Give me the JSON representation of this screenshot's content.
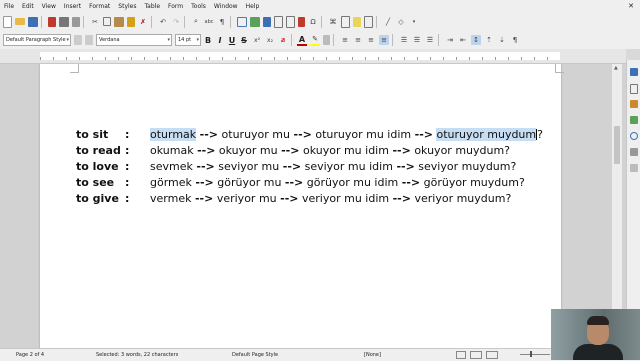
{
  "menubar": {
    "items": [
      "File",
      "Edit",
      "View",
      "Insert",
      "Format",
      "Styles",
      "Table",
      "Form",
      "Tools",
      "Window",
      "Help"
    ],
    "close_glyph": "✕"
  },
  "formatting": {
    "paragraph_style": "Default Paragraph Style",
    "font_name": "Verdana",
    "font_size": "14 pt",
    "bold": "B",
    "italic": "I",
    "underline": "U",
    "strike": "S",
    "font_color": "A"
  },
  "document": {
    "rows": [
      {
        "label": "to sit",
        "colon": ":",
        "w1": "oturmak",
        "w2": "oturuyor mu",
        "w3": "oturuyor mu idim",
        "w4": "oturuyor muydum",
        "end": "?"
      },
      {
        "label": "to read",
        "colon": ":",
        "w1": "okumak",
        "w2": "okuyor mu",
        "w3": "okuyor mu idim",
        "w4": "okuyor muydum?",
        "end": ""
      },
      {
        "label": "to love",
        "colon": ":",
        "w1": "sevmek",
        "w2": "seviyor mu",
        "w3": "seviyor mu idim",
        "w4": "seviyor muydum?",
        "end": ""
      },
      {
        "label": "to see",
        "colon": ":",
        "w1": "görmek",
        "w2": "görüyor mu",
        "w3": "görüyor mu idim",
        "w4": "görüyor muydum?",
        "end": ""
      },
      {
        "label": "to give",
        "colon": ":",
        "w1": "vermek",
        "w2": "veriyor mu",
        "w3": "veriyor mu idim",
        "w4": "veriyor muydum?",
        "end": ""
      }
    ],
    "arrow": "-->"
  },
  "statusbar": {
    "page": "Page 2 of 4",
    "selection": "Selected: 3 words, 22 characters",
    "page_style": "Default Page Style",
    "language": "[None]"
  },
  "colors": {
    "highlight": "#c6ddf3",
    "font_color_bar": "#c00000",
    "highlight_color_bar": "#ffff00"
  }
}
